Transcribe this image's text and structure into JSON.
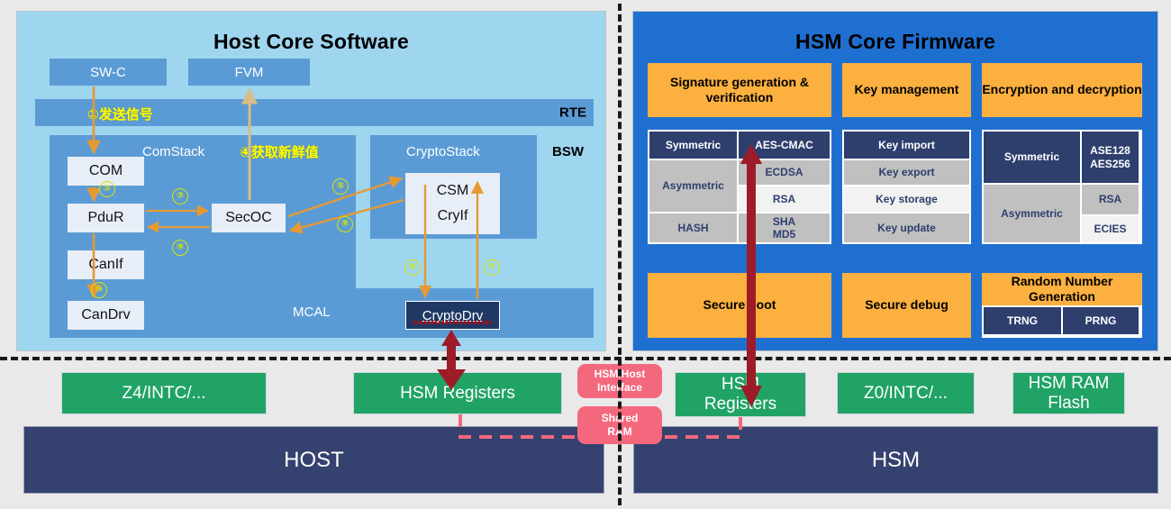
{
  "host_panel": {
    "title": "Host Core Software",
    "app_boxes": [
      {
        "label": "SW-C"
      },
      {
        "label": "FVM"
      }
    ],
    "rte": {
      "label": "RTE",
      "annotation": "①发送信号"
    },
    "bsw_label": "BSW",
    "comstack": {
      "label": "ComStack",
      "modules": [
        "COM",
        "PduR",
        "CanIf"
      ],
      "secoc": "SecOC"
    },
    "cryptostack": {
      "label": "CryptoStack",
      "csm": "CSM",
      "cryif": "CryIf"
    },
    "mcal": {
      "label": "MCAL",
      "candrv": "CanDrv",
      "cryptodrv": "CryptoDrv"
    },
    "fresh_annotation": "④获取新鲜值",
    "callouts": [
      {
        "id": "1",
        "glyph": "①"
      },
      {
        "id": "2",
        "glyph": "②"
      },
      {
        "id": "3",
        "glyph": "③"
      },
      {
        "id": "4",
        "glyph": "④"
      },
      {
        "id": "5",
        "glyph": "⑤"
      },
      {
        "id": "6",
        "glyph": "⑥"
      },
      {
        "id": "7",
        "glyph": "⑦"
      },
      {
        "id": "8",
        "glyph": "⑧"
      },
      {
        "id": "9",
        "glyph": "⑨"
      },
      {
        "id": "10",
        "glyph": "⑩"
      }
    ]
  },
  "hsm_panel": {
    "title": "HSM Core Firmware",
    "features": [
      {
        "header": "Signature generation & verification",
        "left_col": [
          "Symmetric",
          "Asymmetric",
          "HASH"
        ],
        "right_col": [
          "AES-CMAC",
          "ECDSA",
          "RSA",
          "SHA MD5"
        ]
      },
      {
        "header": "Key management",
        "items": [
          "Key import",
          "Key export",
          "Key storage",
          "Key update"
        ]
      },
      {
        "header": "Encryption and decryption",
        "left_col": [
          "Symmetric",
          "Asymmetric"
        ],
        "right_col": [
          "ASE128 AES256",
          "RSA",
          "ECIES"
        ]
      }
    ],
    "bottom": {
      "secure_boot": "Secure boot",
      "secure_debug": "Secure debug",
      "rng_header": "Random Number Generation",
      "rng_items": [
        "TRNG",
        "PRNG"
      ]
    }
  },
  "hardware": {
    "host_side": {
      "blocks": [
        "Z4/INTC/...",
        "HSM Registers"
      ],
      "band": "HOST"
    },
    "hsm_side": {
      "blocks": [
        "HSM Registers",
        "Z0/INTC/...",
        "HSM RAM Flash"
      ],
      "band": "HSM"
    },
    "interfaces": [
      {
        "label": "HSM/Host Interface"
      },
      {
        "label": "Shared RAM"
      }
    ]
  },
  "colors": {
    "host_panel_bg": "#9ed5ef",
    "hsm_panel_bg": "#1f6fd0",
    "blue_box": "#5b9bd5",
    "orange": "#fbb040",
    "navy": "#2e3f6e",
    "grey": "#c0c0c0",
    "green": "#21a366",
    "dark_band": "#35416e",
    "pink": "#f4687e",
    "arrow_orange": "#e59a32",
    "arrow_red": "#9e1b28",
    "callout_yellow": "#d8e400"
  }
}
